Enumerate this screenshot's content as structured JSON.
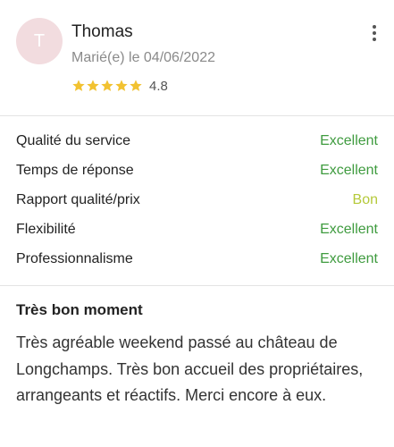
{
  "review": {
    "avatar_initial": "T",
    "author": "Thomas",
    "married_date": "Marié(e) le 04/06/2022",
    "rating": 4.8,
    "rating_label": "4.8",
    "stars": 5,
    "title": "Très bon moment",
    "text": "Très agréable weekend passé au château de Longchamps. Très bon accueil des propriétaires, arrangeants et réactifs. Merci encore à eux."
  },
  "criteria": [
    {
      "label": "Qualité du service",
      "value": "Excellent",
      "color": "#3f9b3f"
    },
    {
      "label": "Temps de réponse",
      "value": "Excellent",
      "color": "#3f9b3f"
    },
    {
      "label": "Rapport qualité/prix",
      "value": "Bon",
      "color": "#b5c93a"
    },
    {
      "label": "Flexibilité",
      "value": "Excellent",
      "color": "#3f9b3f"
    },
    {
      "label": "Professionnalisme",
      "value": "Excellent",
      "color": "#3f9b3f"
    }
  ],
  "colors": {
    "star": "#f2c231",
    "avatar_bg": "#f2dcdf",
    "excellent": "#3f9b3f",
    "bon": "#b5c93a"
  },
  "icons": {
    "star": "star-icon",
    "menu": "more-vertical-icon"
  }
}
